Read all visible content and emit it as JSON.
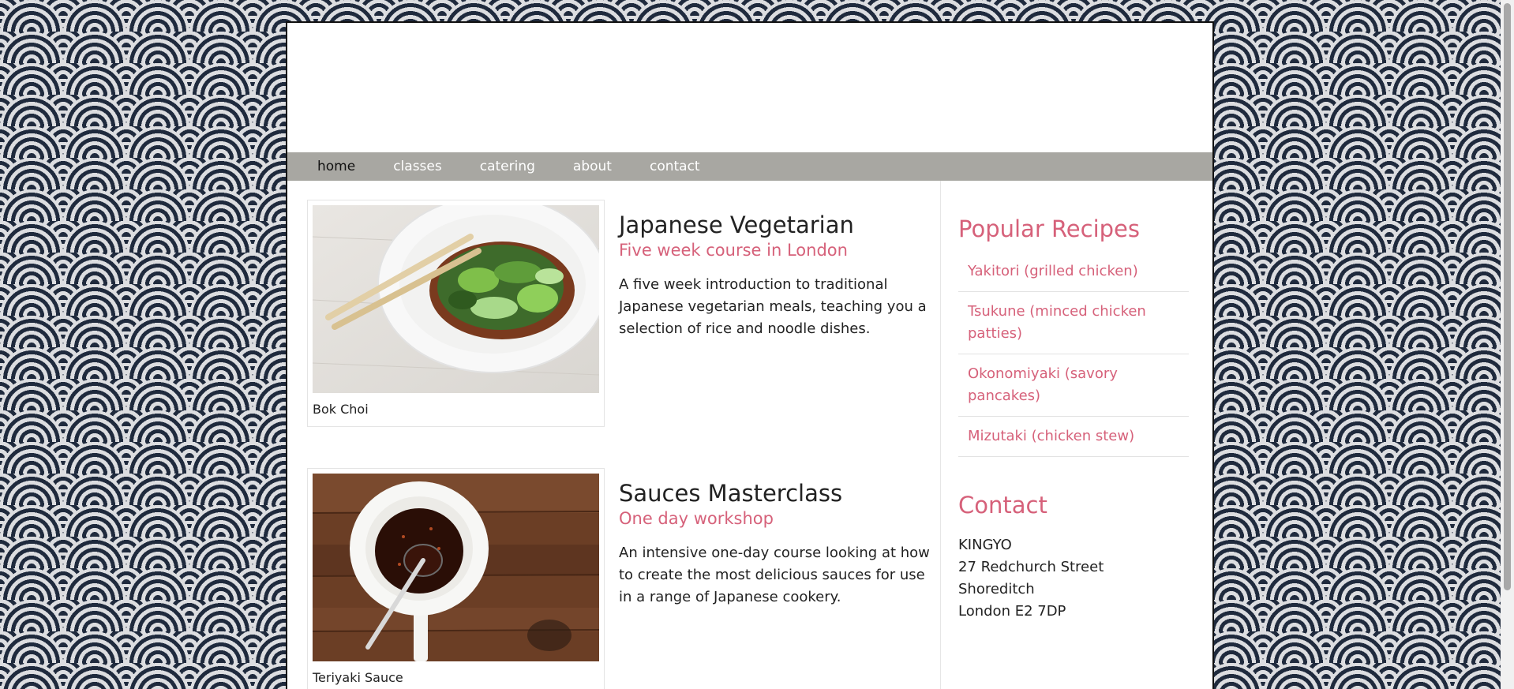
{
  "nav": {
    "items": [
      {
        "label": "home",
        "active": true
      },
      {
        "label": "classes",
        "active": false
      },
      {
        "label": "catering",
        "active": false
      },
      {
        "label": "about",
        "active": false
      },
      {
        "label": "contact",
        "active": false
      }
    ]
  },
  "courses": [
    {
      "image_caption": "Bok Choi",
      "title": "Japanese Vegetarian",
      "subtitle": "Five week course in London",
      "description": "A five week introduction to traditional Japanese vegetarian meals, teaching you a selection of rice and noodle dishes."
    },
    {
      "image_caption": "Teriyaki Sauce",
      "title": "Sauces Masterclass",
      "subtitle": "One day workshop",
      "description": "An intensive one-day course looking at how to create the most delicious sauces for use in a range of Japanese cookery."
    }
  ],
  "sidebar": {
    "recipes_heading": "Popular Recipes",
    "recipes": [
      "Yakitori (grilled chicken)",
      "Tsukune (minced chicken patties)",
      "Okonomiyaki (savory pancakes)",
      "Mizutaki (chicken stew)"
    ],
    "contact_heading": "Contact",
    "address": [
      "KINGYO",
      "27 Redchurch Street",
      "Shoreditch",
      "London E2 7DP"
    ]
  },
  "colors": {
    "accent": "#d6617a",
    "nav_bg": "#a8a7a2",
    "text": "#222222"
  }
}
